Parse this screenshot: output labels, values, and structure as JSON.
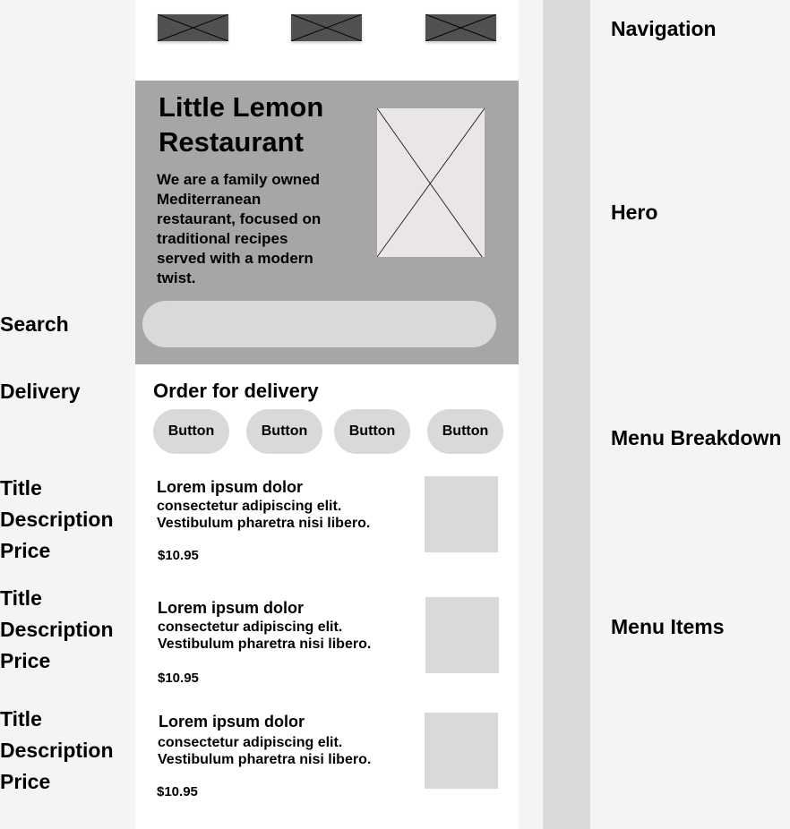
{
  "annotations_left": {
    "search": "Search",
    "delivery": "Delivery",
    "item_fields": [
      "Title",
      "Description",
      "Price"
    ]
  },
  "annotations_right": {
    "navigation": "Navigation",
    "hero": "Hero",
    "menu_breakdown": "Menu Breakdown",
    "menu_items": "Menu Items"
  },
  "hero": {
    "title_line1": "Little Lemon",
    "title_line2": "Restaurant",
    "description": "We are a family owned Mediterranean restaurant, focused on traditional recipes served with a modern twist."
  },
  "delivery": {
    "heading": "Order for delivery",
    "buttons": [
      "Button",
      "Button",
      "Button",
      "Button"
    ]
  },
  "menu_items": [
    {
      "title": "Lorem ipsum dolor",
      "desc1": "consectetur adipiscing elit.",
      "desc2": "Vestibulum pharetra nisi libero.",
      "price": "$10.95"
    },
    {
      "title": "Lorem ipsum dolor",
      "desc1": "consectetur adipiscing elit.",
      "desc2": "Vestibulum pharetra nisi libero.",
      "price": "$10.95"
    },
    {
      "title": "Lorem ipsum dolor",
      "desc1": "consectetur adipiscing elit.",
      "desc2": "Vestibulum pharetra nisi libero.",
      "price": "$10.95"
    }
  ],
  "colors": {
    "nav_placeholder": "#535050",
    "hero_bg": "#a6a6a6",
    "placeholder": "#d9d9d9",
    "hero_image": "#ebe6e6"
  }
}
